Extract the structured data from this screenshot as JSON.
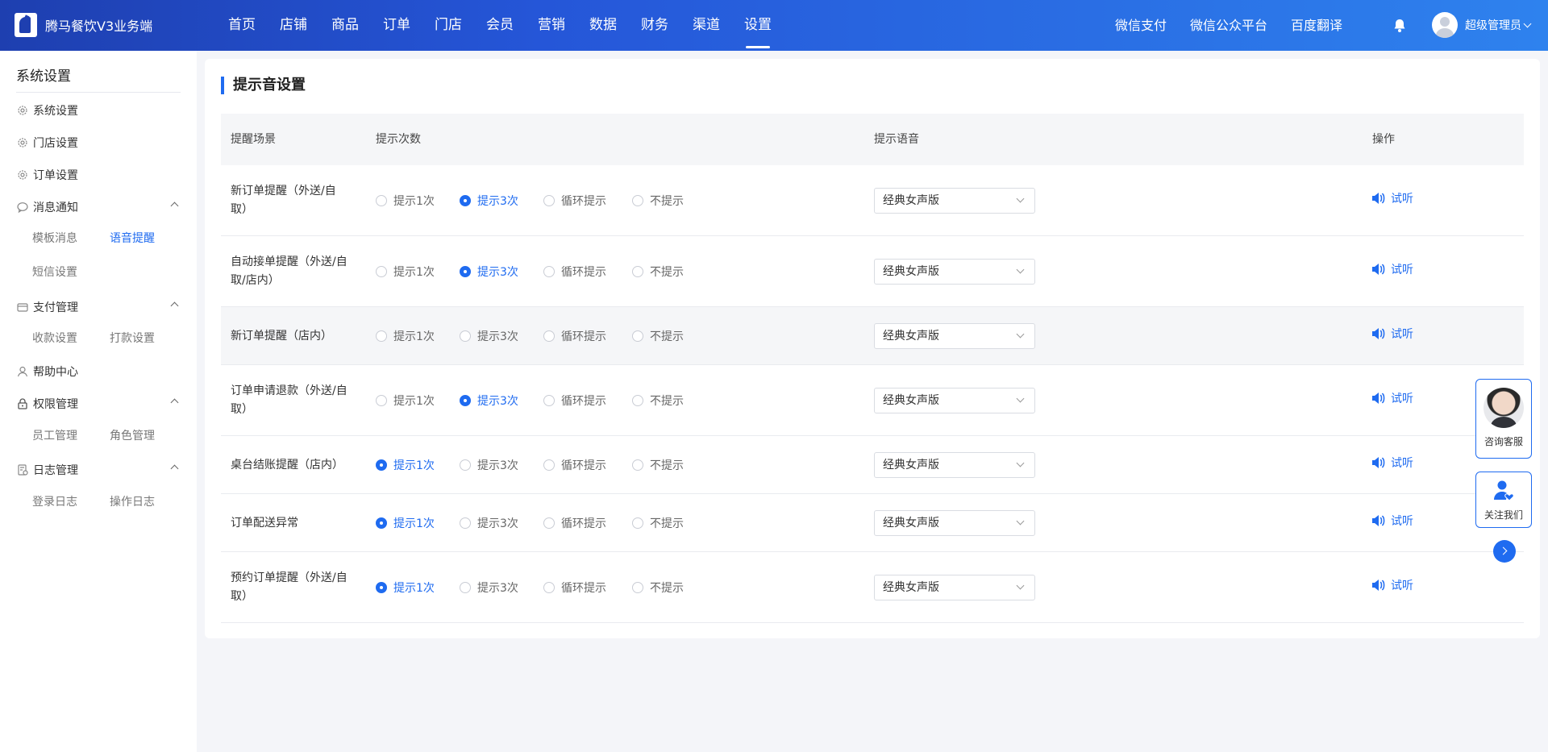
{
  "app": {
    "title": "腾马餐饮V3业务端"
  },
  "nav": {
    "items": [
      "首页",
      "店铺",
      "商品",
      "订单",
      "门店",
      "会员",
      "营销",
      "数据",
      "财务",
      "渠道",
      "设置"
    ],
    "active": "设置"
  },
  "top_links": [
    "微信支付",
    "微信公众平台",
    "百度翻译"
  ],
  "user": {
    "name": "超级管理员"
  },
  "sidebar": {
    "title": "系统设置",
    "items": [
      {
        "label": "系统设置",
        "icon": "gear-icon"
      },
      {
        "label": "门店设置",
        "icon": "gear-icon"
      },
      {
        "label": "订单设置",
        "icon": "gear-icon"
      },
      {
        "label": "消息通知",
        "icon": "chat-icon",
        "sub": [
          "模板消息",
          "语音提醒",
          "短信设置"
        ]
      },
      {
        "label": "支付管理",
        "icon": "wallet-icon",
        "sub": [
          "收款设置",
          "打款设置"
        ]
      },
      {
        "label": "帮助中心",
        "icon": "user-icon"
      },
      {
        "label": "权限管理",
        "icon": "lock-icon",
        "sub": [
          "员工管理",
          "角色管理"
        ]
      },
      {
        "label": "日志管理",
        "icon": "log-icon",
        "sub": [
          "登录日志",
          "操作日志"
        ]
      }
    ],
    "active_sub": "语音提醒"
  },
  "main": {
    "title": "提示音设置",
    "columns": {
      "scene": "提醒场景",
      "count": "提示次数",
      "voice": "提示语音",
      "action": "操作"
    },
    "options": [
      "提示1次",
      "提示3次",
      "循环提示",
      "不提示"
    ],
    "action_label": "试听",
    "rows": [
      {
        "scene": "新订单提醒（外送/自取）",
        "selected": 1,
        "voice": "经典女声版"
      },
      {
        "scene": "自动接单提醒（外送/自取/店内）",
        "selected": 1,
        "voice": "经典女声版"
      },
      {
        "scene": "新订单提醒（店内）",
        "selected": -1,
        "voice": "经典女声版"
      },
      {
        "scene": "订单申请退款（外送/自取）",
        "selected": 1,
        "voice": "经典女声版"
      },
      {
        "scene": "桌台结账提醒（店内）",
        "selected": 0,
        "voice": "经典女声版"
      },
      {
        "scene": "订单配送异常",
        "selected": 0,
        "voice": "经典女声版"
      },
      {
        "scene": "预约订单提醒（外送/自取）",
        "selected": 0,
        "voice": "经典女声版"
      }
    ]
  },
  "float": {
    "service": "咨询客服",
    "follow": "关注我们"
  },
  "colors": {
    "accent": "#1f6bf0",
    "header_start": "#1e3fb0",
    "header_end": "#2e82ee"
  }
}
